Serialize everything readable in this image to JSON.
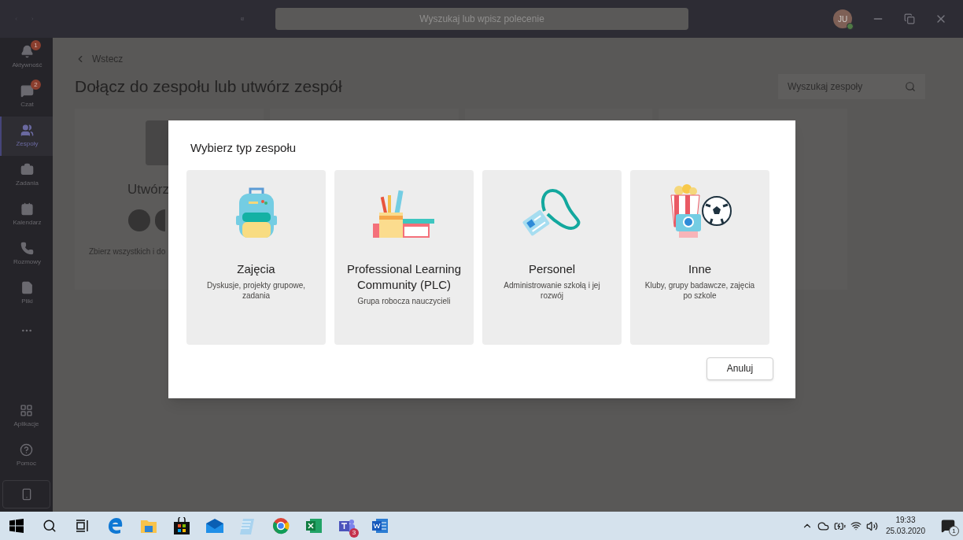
{
  "title_bar": {
    "search": {
      "placeholder": "Wyszukaj lub wpisz polecenie"
    },
    "avatar": {
      "initials": "JU"
    }
  },
  "sidebar": {
    "items": [
      {
        "kind": "activity",
        "label": "Aktywność",
        "badge": "1",
        "selected": false
      },
      {
        "kind": "chat",
        "label": "Czat",
        "badge": "2",
        "selected": false
      },
      {
        "kind": "teams",
        "label": "Zespoły",
        "selected": true
      },
      {
        "kind": "assignments",
        "label": "Zadania",
        "selected": false
      },
      {
        "kind": "calendar",
        "label": "Kalendarz",
        "selected": false
      },
      {
        "kind": "calls",
        "label": "Rozmowy",
        "selected": false
      },
      {
        "kind": "files",
        "label": "Pliki",
        "selected": false
      }
    ],
    "bottom_items": [
      {
        "kind": "apps",
        "label": "Aplikacje"
      },
      {
        "kind": "help",
        "label": "Pomoc"
      }
    ]
  },
  "page": {
    "back_link": "Wstecz",
    "heading": "Dołącz do zespołu lub utwórz zespół",
    "search": {
      "placeholder": "Wyszukaj zespoły"
    },
    "create_card": {
      "title": "Utwórz",
      "description": "Zbierz wszystkich i do"
    }
  },
  "dialog": {
    "title": "Wybierz typ zespołu",
    "options": [
      {
        "kind": "class",
        "title": "Zajęcia",
        "description": "Dyskusje, projekty grupowe, zadania"
      },
      {
        "kind": "plc",
        "title": "Professional Learning Community (PLC)",
        "description": "Grupa robocza nauczycieli"
      },
      {
        "kind": "staff",
        "title": "Personel",
        "description": "Administrowanie szkołą i jej rozwój"
      },
      {
        "kind": "other",
        "title": "Inne",
        "description": "Kluby, grupy badawcze, zajęcia po szkole"
      }
    ],
    "cancel_button": "Anuluj"
  },
  "taskbar": {
    "apps": [
      {
        "kind": "start"
      },
      {
        "kind": "search"
      },
      {
        "kind": "taskview"
      },
      {
        "kind": "edge"
      },
      {
        "kind": "explorer"
      },
      {
        "kind": "store"
      },
      {
        "kind": "mail"
      },
      {
        "kind": "notepad"
      },
      {
        "kind": "chrome"
      },
      {
        "kind": "excel"
      },
      {
        "kind": "teams",
        "badge": "3"
      },
      {
        "kind": "word"
      }
    ],
    "time": "19:33",
    "date": "25.03.2020",
    "notifications": "1"
  }
}
